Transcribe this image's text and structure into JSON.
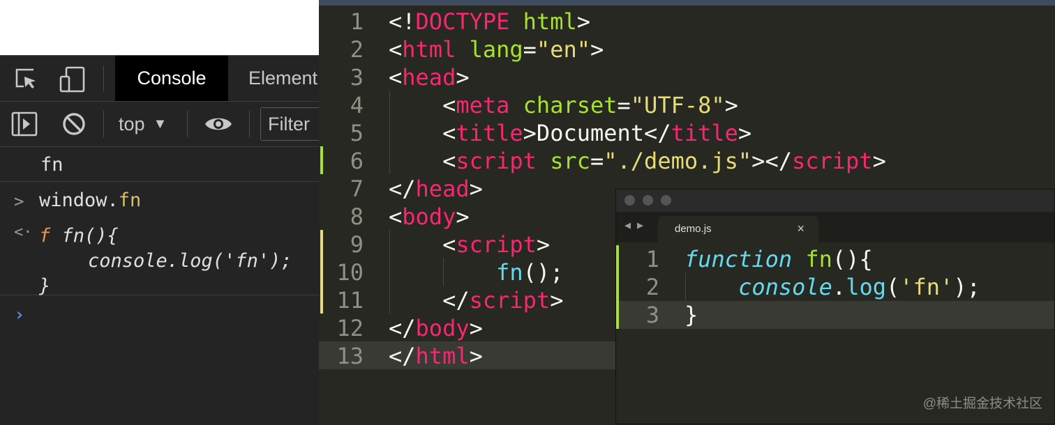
{
  "devtools": {
    "tabs": {
      "console": "Console",
      "elements": "Element"
    },
    "context": "top",
    "filter_placeholder": "Filter",
    "console": {
      "line0": "fn",
      "input": {
        "obj": "window.",
        "prop": "fn"
      },
      "result": {
        "keyword": "f",
        "signature": "fn(){",
        "body": "console.log('fn');",
        "close": "}"
      }
    }
  },
  "editor": {
    "line_numbers": [
      "1",
      "2",
      "3",
      "4",
      "5",
      "6",
      "7",
      "8",
      "9",
      "10",
      "11",
      "12",
      "13"
    ],
    "lines": [
      [
        {
          "t": "<!"
        },
        {
          "t": "DOCTYPE",
          "c": "tg"
        },
        {
          "t": " "
        },
        {
          "t": "html",
          "c": "at"
        },
        {
          "t": ">"
        }
      ],
      [
        {
          "t": "<"
        },
        {
          "t": "html",
          "c": "tg"
        },
        {
          "t": " "
        },
        {
          "t": "lang",
          "c": "at"
        },
        {
          "t": "="
        },
        {
          "t": "\"en\"",
          "c": "st"
        },
        {
          "t": ">"
        }
      ],
      [
        {
          "t": "<"
        },
        {
          "t": "head",
          "c": "tg"
        },
        {
          "t": ">"
        }
      ],
      [
        {
          "t": "    <"
        },
        {
          "t": "meta",
          "c": "tg"
        },
        {
          "t": " "
        },
        {
          "t": "charset",
          "c": "at"
        },
        {
          "t": "="
        },
        {
          "t": "\"UTF-8\"",
          "c": "st"
        },
        {
          "t": ">"
        }
      ],
      [
        {
          "t": "    <"
        },
        {
          "t": "title",
          "c": "tg"
        },
        {
          "t": ">Document</"
        },
        {
          "t": "title",
          "c": "tg"
        },
        {
          "t": ">"
        }
      ],
      [
        {
          "t": "    <"
        },
        {
          "t": "script",
          "c": "tg"
        },
        {
          "t": " "
        },
        {
          "t": "src",
          "c": "at"
        },
        {
          "t": "="
        },
        {
          "t": "\"./demo.js\"",
          "c": "st"
        },
        {
          "t": "></"
        },
        {
          "t": "script",
          "c": "tg"
        },
        {
          "t": ">"
        }
      ],
      [
        {
          "t": "</"
        },
        {
          "t": "head",
          "c": "tg"
        },
        {
          "t": ">"
        }
      ],
      [
        {
          "t": "<"
        },
        {
          "t": "body",
          "c": "tg"
        },
        {
          "t": ">"
        }
      ],
      [
        {
          "t": "    <"
        },
        {
          "t": "script",
          "c": "tg"
        },
        {
          "t": ">"
        }
      ],
      [
        {
          "t": "        "
        },
        {
          "t": "fn",
          "c": "fn"
        },
        {
          "t": "();"
        }
      ],
      [
        {
          "t": "    </"
        },
        {
          "t": "script",
          "c": "tg"
        },
        {
          "t": ">"
        }
      ],
      [
        {
          "t": "</"
        },
        {
          "t": "body",
          "c": "tg"
        },
        {
          "t": ">"
        }
      ],
      [
        {
          "t": "</"
        },
        {
          "t": "html",
          "c": "tg"
        },
        {
          "t": ">"
        }
      ]
    ]
  },
  "floating_editor": {
    "tab_label": "demo.js",
    "line_numbers": [
      "1",
      "2",
      "3"
    ],
    "lines": [
      [
        {
          "t": "function",
          "c": "kw"
        },
        {
          "t": " "
        },
        {
          "t": "fn",
          "c": "at"
        },
        {
          "t": "(){"
        }
      ],
      [
        {
          "t": "    "
        },
        {
          "t": "console",
          "c": "kw"
        },
        {
          "t": "."
        },
        {
          "t": "log",
          "c": "fn"
        },
        {
          "t": "("
        },
        {
          "t": "'fn'",
          "c": "st"
        },
        {
          "t": ");"
        }
      ],
      [
        {
          "t": "}"
        }
      ]
    ]
  },
  "watermark": "@稀土掘金技术社区",
  "colors": {
    "tag": "#f92672",
    "attr": "#a6e22e",
    "string": "#e6db74",
    "func": "#66d9ef",
    "editor_bg": "#272822",
    "devtools_bg": "#242424"
  }
}
